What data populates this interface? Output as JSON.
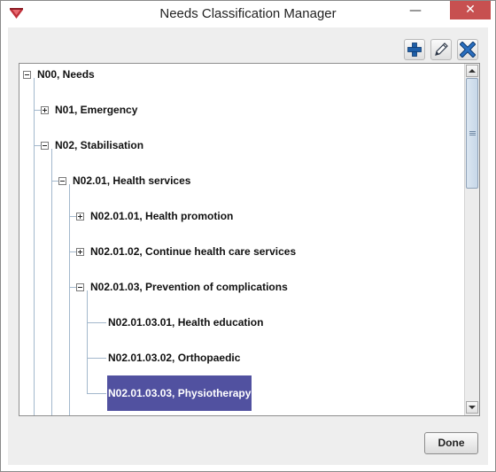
{
  "window": {
    "title": "Needs Classification Manager",
    "minimize_glyph": "—",
    "close_glyph": "✕"
  },
  "toolbar": {
    "add_icon": "plus-icon",
    "edit_icon": "pencil-icon",
    "delete_icon": "x-icon"
  },
  "tree": {
    "nodes": [
      {
        "label": "N00, Needs",
        "expanded": true
      },
      {
        "label": "N01, Emergency",
        "expanded": false
      },
      {
        "label": "N02, Stabilisation",
        "expanded": true
      },
      {
        "label": "N02.01, Health services",
        "expanded": true
      },
      {
        "label": "N02.01.01, Health promotion",
        "expanded": false
      },
      {
        "label": "N02.01.02, Continue health care services",
        "expanded": false
      },
      {
        "label": "N02.01.03, Prevention of complications",
        "expanded": true
      },
      {
        "label": "N02.01.03.01, Health education"
      },
      {
        "label": "N02.01.03.02, Orthopaedic"
      },
      {
        "label": "N02.01.03.03, Physiotherapy",
        "selected": true
      }
    ]
  },
  "footer": {
    "done_label": "Done"
  },
  "colors": {
    "selection": "#5151a0",
    "close_button": "#c75050",
    "tree_lines": "#a3b8cc",
    "add_icon": "#1f5fa8",
    "delete_icon": "#1f5fa8"
  }
}
